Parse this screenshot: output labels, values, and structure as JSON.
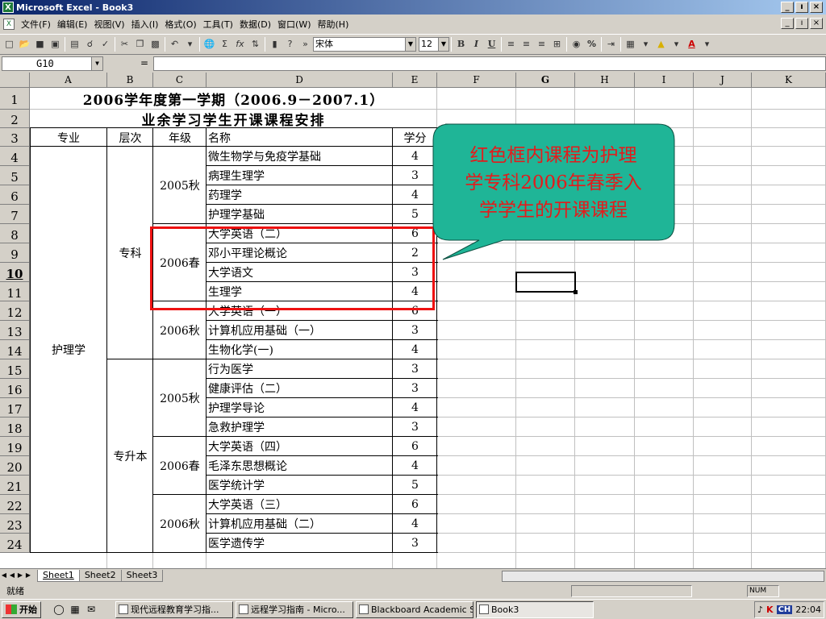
{
  "window": {
    "title": "Microsoft Excel - Book3",
    "min_label": "_",
    "restore_label": "ı",
    "close_label": "×"
  },
  "menu": [
    "文件(F)",
    "编辑(E)",
    "视图(V)",
    "插入(I)",
    "格式(O)",
    "工具(T)",
    "数据(D)",
    "窗口(W)",
    "帮助(H)"
  ],
  "toolbar": {
    "font_name": "宋体",
    "font_size": "12",
    "bold": "B",
    "italic": "I",
    "underline": "U",
    "percent": "%",
    "sigma": "Σ",
    "fx": "fx"
  },
  "formula": {
    "name_box": "G10",
    "eq": "=",
    "content": ""
  },
  "columns": [
    "A",
    "B",
    "C",
    "D",
    "E",
    "F",
    "G",
    "H",
    "I",
    "J",
    "K"
  ],
  "rows": [
    "1",
    "2",
    "3",
    "4",
    "5",
    "6",
    "7",
    "8",
    "9",
    "10",
    "11",
    "12",
    "13",
    "14",
    "15",
    "16",
    "17",
    "18",
    "19",
    "20",
    "21",
    "22",
    "23",
    "24"
  ],
  "selected_col": "G",
  "selected_row": "10",
  "sheet": {
    "title1": "2006学年度第一学期（2006.9－2007.1）",
    "title2": "业余学习学生开课课程安排",
    "headers": [
      "专业",
      "层次",
      "年级",
      "名称",
      "学分"
    ],
    "major": "护理学",
    "level1": "专科",
    "level2": "专升本",
    "grades": [
      "2005秋",
      "2006春",
      "2006秋",
      "2005秋",
      "2006春",
      "2006秋"
    ],
    "courses": [
      {
        "name": "微生物学与免疫学基础",
        "credit": "4"
      },
      {
        "name": "病理生理学",
        "credit": "3"
      },
      {
        "name": "药理学",
        "credit": "4"
      },
      {
        "name": "护理学基础",
        "credit": "5"
      },
      {
        "name": "大学英语（二）",
        "credit": "6"
      },
      {
        "name": "邓小平理论概论",
        "credit": "2"
      },
      {
        "name": "大学语文",
        "credit": "3"
      },
      {
        "name": "生理学",
        "credit": "4"
      },
      {
        "name": "大学英语（一）",
        "credit": "6"
      },
      {
        "name": "计算机应用基础（一）",
        "credit": "3"
      },
      {
        "name": "生物化学(一)",
        "credit": "4"
      },
      {
        "name": "行为医学",
        "credit": "3"
      },
      {
        "name": "健康评估（二）",
        "credit": "3"
      },
      {
        "name": "护理学导论",
        "credit": "4"
      },
      {
        "name": "急救护理学",
        "credit": "3"
      },
      {
        "name": "大学英语（四）",
        "credit": "6"
      },
      {
        "name": "毛泽东思想概论",
        "credit": "4"
      },
      {
        "name": "医学统计学",
        "credit": "5"
      },
      {
        "name": "大学英语（三）",
        "credit": "6"
      },
      {
        "name": "计算机应用基础（二）",
        "credit": "4"
      },
      {
        "name": "医学遗传学",
        "credit": "3"
      }
    ]
  },
  "callout": {
    "line1": "红色框内课程为护理",
    "line2": "学专科2006年春季入",
    "line3": "学学生的开课课程",
    "bubble_color": "#1fb597",
    "text_color": "#e41b1b",
    "box_color": "#ee1111"
  },
  "tabs": [
    "Sheet1",
    "Sheet2",
    "Sheet3"
  ],
  "status": {
    "ready": "就绪",
    "num": "NUM"
  },
  "taskbar": {
    "start": "开始",
    "items": [
      "现代远程教育学习指...",
      "远程学习指南 - Micro...",
      "Blackboard Academic S...",
      "Book3"
    ],
    "ime": "CH",
    "clock": "22:04"
  }
}
